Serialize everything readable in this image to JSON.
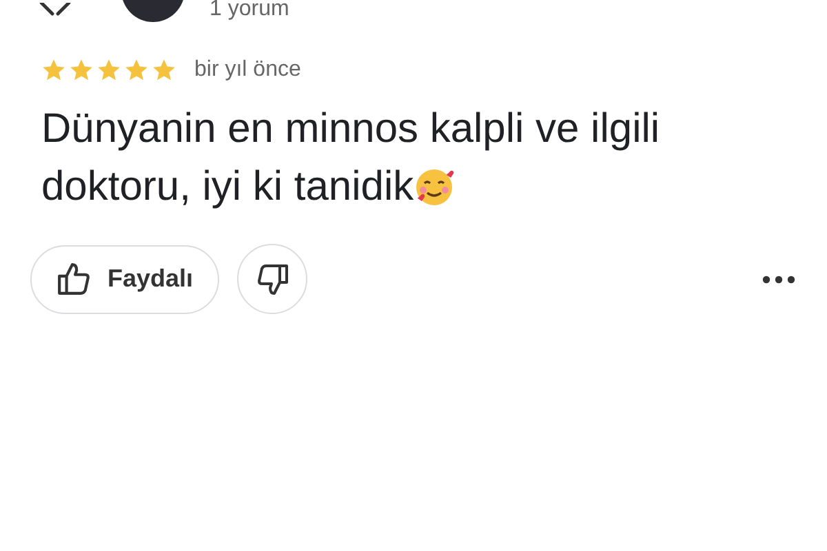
{
  "reviewer": {
    "review_count": "1 yorum"
  },
  "review": {
    "stars": 5,
    "time": "bir yıl önce",
    "text_lines": [
      "Dünyanin en minnos kalpli ve ilgili",
      "doktoru, iyi ki tanidik"
    ]
  },
  "actions": {
    "helpful_label": "Faydalı"
  }
}
